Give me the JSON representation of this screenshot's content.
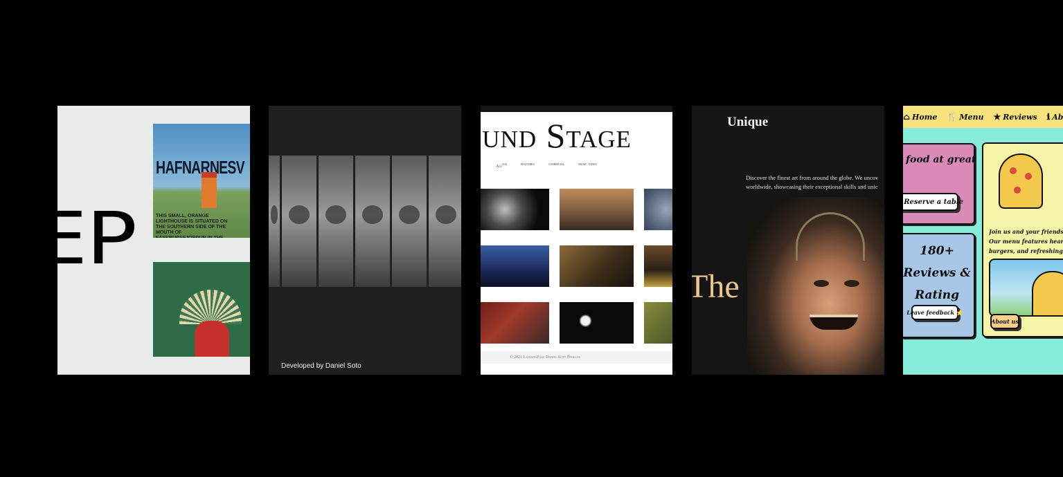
{
  "card1": {
    "big_text": "EP",
    "poster1_title": "HAFNARNESV",
    "poster1_text": "THIS SMALL, ORANGE LIGHTHOUSE IS SITUATED ON THE SOUTHERN SIDE OF THE MOUTH OF FÁSKRÚÐSFJÖRÐUR IN THE WEST OF ICELAND"
  },
  "card2": {
    "credit": "Developed by Daniel Soto"
  },
  "card3": {
    "title": "ound Stage",
    "nav": [
      "All",
      "features",
      "comercial",
      "music video"
    ],
    "nav_sup": "(18)",
    "footer": "© 2021 LandingPage Daniel Soto Pinillos"
  },
  "card4": {
    "heading": "Unique",
    "desc_line1": "Discover the finest art from around the globe. We uncov",
    "desc_line2": "worldwide, showcasing their exceptional skills and unic",
    "large_text": "The"
  },
  "card5": {
    "nav": [
      {
        "icon": "house-icon",
        "glyph": "⌂",
        "label": "Home"
      },
      {
        "icon": "utensils-icon",
        "glyph": "🍴",
        "label": "Menu"
      },
      {
        "icon": "star-icon",
        "glyph": "★",
        "label": "Reviews"
      },
      {
        "icon": "info-icon",
        "glyph": "ℹ",
        "label": "About"
      }
    ],
    "promo": "food at great",
    "reserve_button": "🍽 Reserve a table",
    "reviews_line1": "180+",
    "reviews_line2": "Reviews &",
    "reviews_line3": "Rating",
    "feedback_button": "Leave feedback ⭐",
    "body_line1": "Join us and your friends for a",
    "body_line2": "Our menu features hearty lu",
    "body_line3": "burgers, and refreshing drinks.",
    "about_button": "About us"
  },
  "colors": {
    "background": "#000000",
    "card5_nav": "#f7e27c",
    "card5_bg": "#87ecd9",
    "card4_accent": "#e8c98c"
  }
}
